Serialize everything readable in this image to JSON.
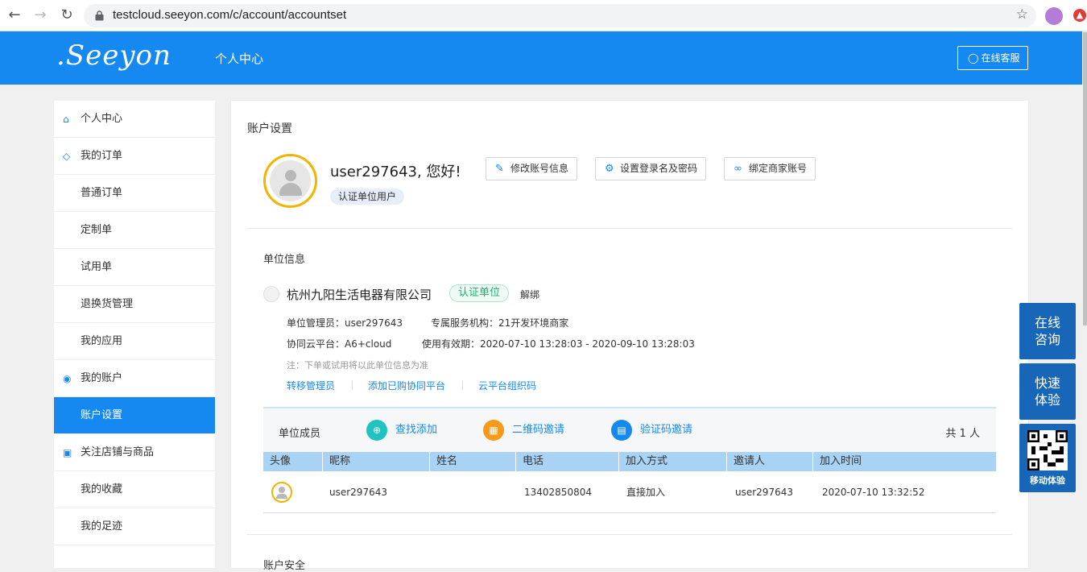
{
  "browser": {
    "url": "testcloud.seeyon.com/c/account/accountset"
  },
  "header": {
    "logo": ".Seeyon",
    "title": "个人中心",
    "service_button": "在线客服"
  },
  "sidebar": {
    "items": [
      {
        "label": "个人中心",
        "icon": "home-icon"
      },
      {
        "label": "我的订单",
        "icon": "layers-icon"
      },
      {
        "label": "普通订单"
      },
      {
        "label": "定制单"
      },
      {
        "label": "试用单"
      },
      {
        "label": "退换货管理"
      },
      {
        "label": "我的应用"
      },
      {
        "label": "我的账户",
        "icon": "user-circle-icon"
      },
      {
        "label": "账户设置",
        "active": true
      },
      {
        "label": "关注店铺与商品",
        "icon": "store-icon"
      },
      {
        "label": "我的收藏"
      },
      {
        "label": "我的足迹"
      }
    ]
  },
  "main": {
    "title": "账户设置",
    "greeting": "user297643, 您好!",
    "user_badge": "认证单位用户",
    "actions": {
      "edit_info": "修改账号信息",
      "set_login": "设置登录名及密码",
      "bind_merchant": "绑定商家账号"
    },
    "unit": {
      "section_label": "单位信息",
      "company_name": "杭州九阳生活电器有限公司",
      "verified_badge": "认证单位",
      "unbind": "解绑",
      "admin": "单位管理员：user297643",
      "service_org": "专属服务机构：21开发环境商家",
      "platform": "协同云平台：A6+cloud",
      "validity": "使用有效期：2020-07-10 13:28:03 - 2020-09-10 13:28:03",
      "note": "注：下单或试用将以此单位信息为准",
      "links": {
        "transfer_admin": "转移管理员",
        "add_platform": "添加已购协同平台",
        "org_code": "云平台组织码"
      }
    },
    "members": {
      "label": "单位成员",
      "search_add": "查找添加",
      "qr_invite": "二维码邀请",
      "code_invite": "验证码邀请",
      "count": "共 1 人",
      "columns": [
        "头像",
        "昵称",
        "姓名",
        "电话",
        "加入方式",
        "邀请人",
        "加入时间"
      ],
      "rows": [
        {
          "nickname": "user297643",
          "name": "",
          "phone": "13402850804",
          "join_method": "直接加入",
          "inviter": "user297643",
          "join_time": "2020-07-10 13:32:52"
        }
      ]
    },
    "bottom_section": "账户安全"
  },
  "float": {
    "consult": "在线\n咨询",
    "trial": "快速\n体验",
    "mobile": "移动体验"
  },
  "colors": {
    "brand_blue": "#1589f0",
    "float_blue": "#1866b8",
    "verified_green": "#19b26b",
    "avatar_ring": "#f5b300"
  }
}
